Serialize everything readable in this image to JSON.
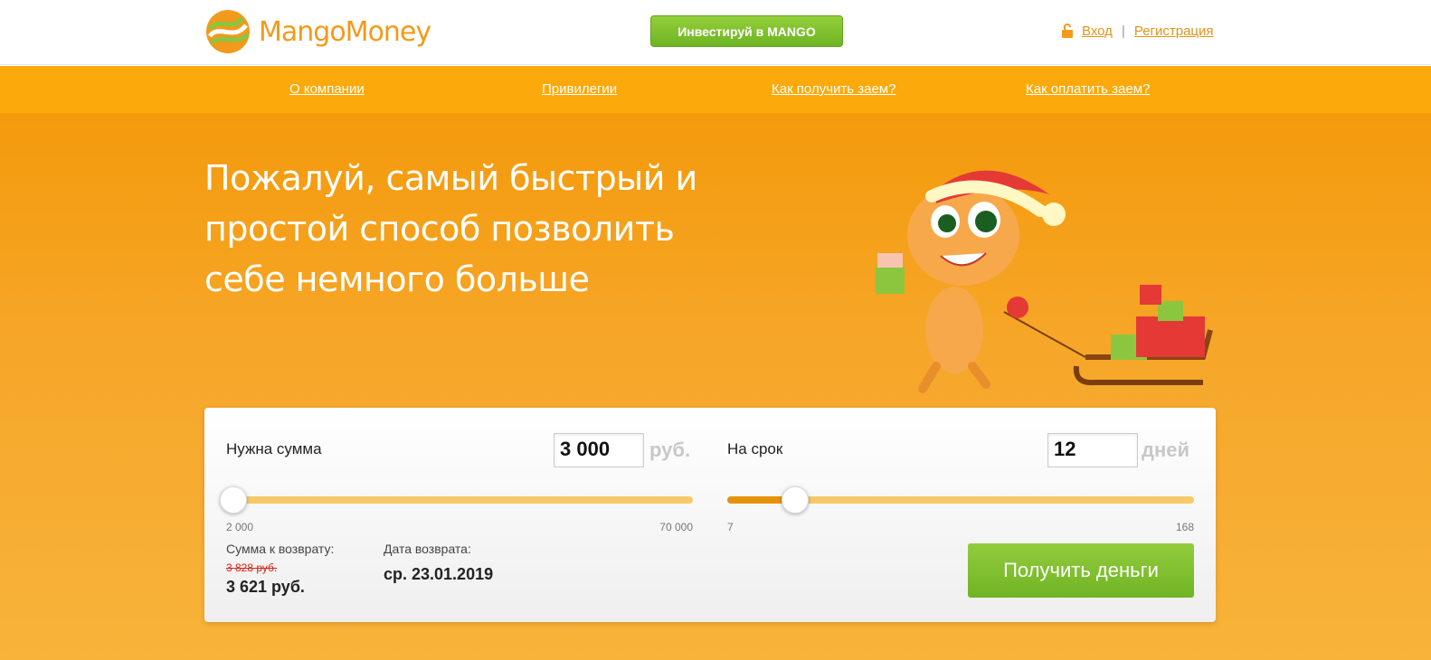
{
  "brand": {
    "name": "MangoMoney",
    "accent": "#f29a1c"
  },
  "header": {
    "invest_label": "Инвестируй в MANGO",
    "login_label": "Вход",
    "register_label": "Регистрация"
  },
  "nav": {
    "items": [
      {
        "label": "О компании"
      },
      {
        "label": "Привилегии"
      },
      {
        "label": "Как получить заем?"
      },
      {
        "label": "Как оплатить заем?"
      }
    ]
  },
  "hero": {
    "headline_line1": "Пожалуй, самый быстрый и",
    "headline_line2": "простой способ позволить",
    "headline_line3": "себе немного больше"
  },
  "calculator": {
    "amount": {
      "label": "Нужна сумма",
      "value": "3 000",
      "unit": "руб.",
      "min": "2 000",
      "max": "70 000",
      "fraction": 0.015
    },
    "term": {
      "label": "На срок",
      "value": "12",
      "unit": "дней",
      "min": "7",
      "max": "168",
      "fraction": 0.145
    },
    "repay_label": "Сумма к возврату:",
    "repay_old": "3 828 руб.",
    "repay_value": "3 621 руб.",
    "date_label": "Дата возврата:",
    "date_value": "ср. 23.01.2019",
    "submit_label": "Получить деньги"
  }
}
